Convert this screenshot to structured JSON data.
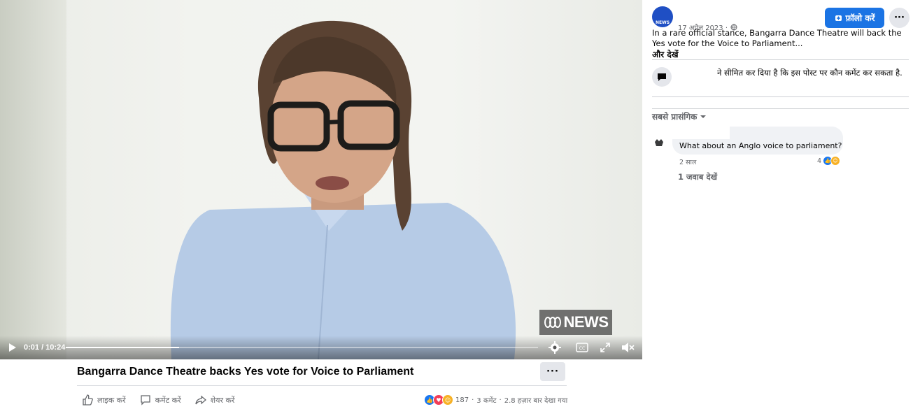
{
  "video": {
    "watermark": "NEWS",
    "time": "0:01 / 10:24",
    "progress": 0.24
  },
  "post": {
    "title": "Bangarra Dance Theatre backs Yes vote for Voice to Parliament",
    "more_label": "···",
    "actions": {
      "like": "लाइक करें",
      "comment": "कमेंट करें",
      "share": "शेयर करें"
    },
    "stats": {
      "reactions": "187",
      "comments": "3 कमेंट",
      "views": "2.8 हज़ार बार देखा गया",
      "separator": "·"
    }
  },
  "sidebar": {
    "avatar_text": "NEWS",
    "date": "17 अप्रैल 2023 ·",
    "follow_label": "फ़ॉलो करें",
    "more_label": "···",
    "post_text": "In a rare official stance, Bangarra Dance Theatre will back the Yes vote for the Voice to Parliament...",
    "see_more": "और देखें",
    "notice": "ने सीमित कर दिया है कि इस पोस्ट पर कौन कमेंट कर सकता है.",
    "sort_label": "सबसे प्रासंगिक",
    "comment": {
      "text": "What about an Anglo voice to parliament?",
      "time": "2 साल",
      "reactions": "4",
      "replies": "1 जवाब देखें"
    }
  },
  "colors": {
    "accent": "#1b74e4",
    "like": "#1877f2",
    "love": "#f33e58",
    "haha": "#f7b125"
  }
}
